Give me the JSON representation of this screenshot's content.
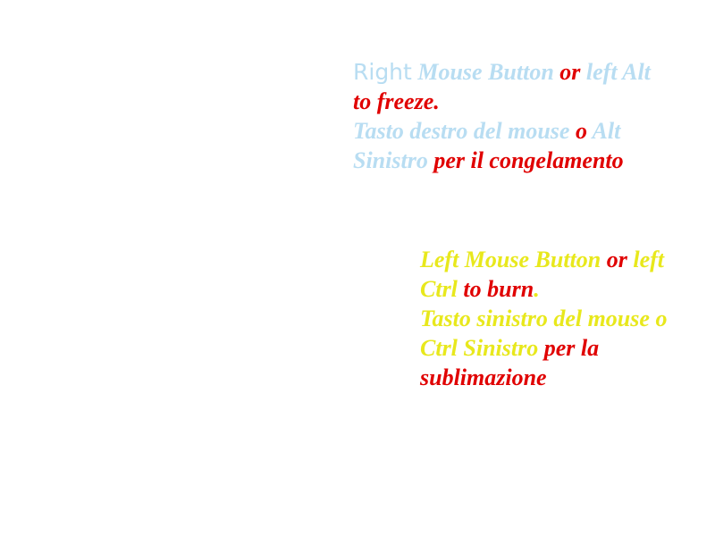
{
  "freeze_hint": {
    "en_word_right": "Right",
    "en_mouse_button": "Mouse Button",
    "en_or": "or",
    "en_left_alt": "left Alt",
    "en_action": "to freeze.",
    "it_right_mouse": "Tasto destro del mouse",
    "it_o": "o",
    "it_alt": "Alt",
    "it_sinistro": "Sinistro",
    "it_action": "per il congelamento"
  },
  "burn_hint": {
    "en_left_mouse_button": "Left Mouse Button",
    "en_or": "or",
    "en_left": "left",
    "en_ctrl": "Ctrl",
    "en_action": "to burn",
    "en_period": ".",
    "it_left_mouse": "Tasto sinistro del mouse",
    "it_o": "o",
    "it_ctrl_sinistro": "Ctrl Sinistro",
    "it_per_la": "per la",
    "it_action": "sublimazione"
  },
  "colors": {
    "background": "#ffffff",
    "freeze_highlight": "#b8ddf2",
    "burn_highlight": "#e8e81c",
    "instruction_text": "#e00000"
  }
}
